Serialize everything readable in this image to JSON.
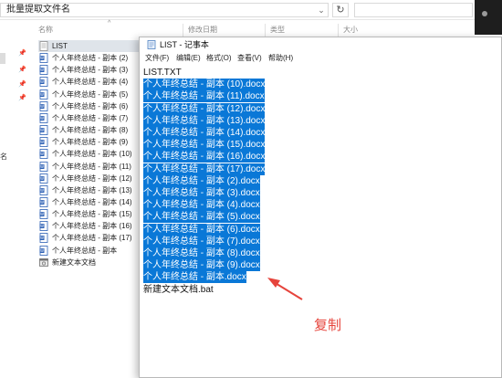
{
  "explorer": {
    "address": "批量提取文件名",
    "columns": {
      "name": "名称",
      "modified": "修改日期",
      "type": "类型",
      "size": "大小"
    },
    "sidebar_label": "名",
    "files": [
      {
        "label": "LIST",
        "kind": "txt",
        "selected": true
      },
      {
        "label": "个人年终总结 - 副本 (2)",
        "kind": "word"
      },
      {
        "label": "个人年终总结 - 副本 (3)",
        "kind": "word"
      },
      {
        "label": "个人年终总结 - 副本 (4)",
        "kind": "word"
      },
      {
        "label": "个人年终总结 - 副本 (5)",
        "kind": "word"
      },
      {
        "label": "个人年终总结 - 副本 (6)",
        "kind": "word"
      },
      {
        "label": "个人年终总结 - 副本 (7)",
        "kind": "word"
      },
      {
        "label": "个人年终总结 - 副本 (8)",
        "kind": "word"
      },
      {
        "label": "个人年终总结 - 副本 (9)",
        "kind": "word"
      },
      {
        "label": "个人年终总结 - 副本 (10)",
        "kind": "word"
      },
      {
        "label": "个人年终总结 - 副本 (11)",
        "kind": "word"
      },
      {
        "label": "个人年终总结 - 副本 (12)",
        "kind": "word"
      },
      {
        "label": "个人年终总结 - 副本 (13)",
        "kind": "word"
      },
      {
        "label": "个人年终总结 - 副本 (14)",
        "kind": "word"
      },
      {
        "label": "个人年终总结 - 副本 (15)",
        "kind": "word"
      },
      {
        "label": "个人年终总结 - 副本 (16)",
        "kind": "word"
      },
      {
        "label": "个人年终总结 - 副本 (17)",
        "kind": "word"
      },
      {
        "label": "个人年终总结 - 副本",
        "kind": "word"
      },
      {
        "label": "新建文本文档",
        "kind": "bat"
      }
    ]
  },
  "notepad": {
    "title": "LIST - 记事本",
    "menu": [
      "文件(F)",
      "编辑(E)",
      "格式(O)",
      "查看(V)",
      "帮助(H)"
    ],
    "lines": [
      {
        "text": "LIST.TXT",
        "highlighted": false
      },
      {
        "text": "个人年终总结 - 副本 (10).docx",
        "highlighted": true
      },
      {
        "text": "个人年终总结 - 副本 (11).docx",
        "highlighted": true
      },
      {
        "text": "个人年终总结 - 副本 (12).docx",
        "highlighted": true
      },
      {
        "text": "个人年终总结 - 副本 (13).docx",
        "highlighted": true
      },
      {
        "text": "个人年终总结 - 副本 (14).docx",
        "highlighted": true
      },
      {
        "text": "个人年终总结 - 副本 (15).docx",
        "highlighted": true
      },
      {
        "text": "个人年终总结 - 副本 (16).docx",
        "highlighted": true
      },
      {
        "text": "个人年终总结 - 副本 (17).docx",
        "highlighted": true
      },
      {
        "text": "个人年终总结 - 副本 (2).docx",
        "highlighted": true
      },
      {
        "text": "个人年终总结 - 副本 (3).docx",
        "highlighted": true
      },
      {
        "text": "个人年终总结 - 副本 (4).docx",
        "highlighted": true
      },
      {
        "text": "个人年终总结 - 副本 (5).docx",
        "highlighted": true
      },
      {
        "text": "个人年终总结 - 副本 (6).docx",
        "highlighted": true
      },
      {
        "text": "个人年终总结 - 副本 (7).docx",
        "highlighted": true
      },
      {
        "text": "个人年终总结 - 副本 (8).docx",
        "highlighted": true
      },
      {
        "text": "个人年终总结 - 副本 (9).docx",
        "highlighted": true
      },
      {
        "text": "个人年终总结 - 副本.docx",
        "highlighted": true
      },
      {
        "text": "新建文本文档.bat",
        "highlighted": false
      }
    ]
  },
  "annotation": {
    "text": "复制",
    "color": "#e6443c"
  },
  "colors": {
    "selection": "#0a78d7",
    "selected_row": "#dfe4ea",
    "word_icon": "#2b5fb4"
  },
  "icons": {
    "refresh": "↻",
    "dropdown": "⌄",
    "pin": "📌"
  }
}
